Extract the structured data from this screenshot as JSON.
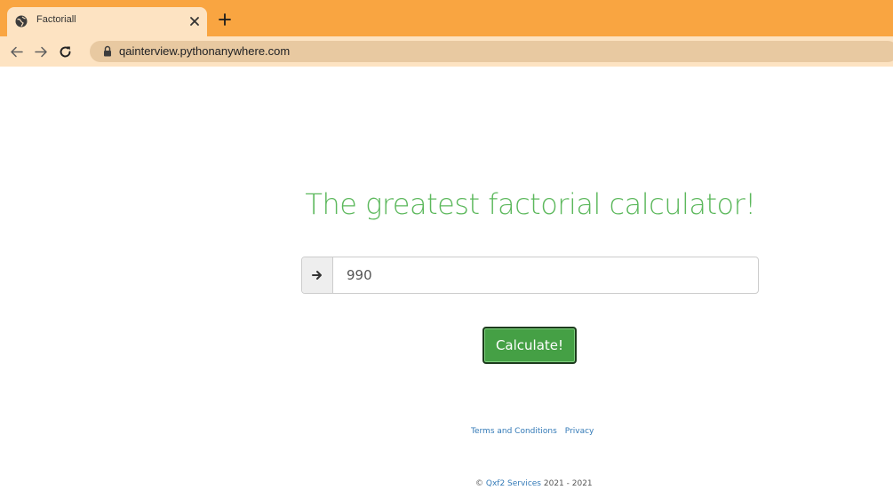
{
  "browser": {
    "tab_title": "Factoriall",
    "url": "qainterview.pythonanywhere.com"
  },
  "page": {
    "title": "The greatest factorial calculator!",
    "input_value": "990",
    "button_label": "Calculate!"
  },
  "footer": {
    "links": [
      "Terms and Conditions",
      "Privacy"
    ],
    "copyright_symbol": "©",
    "company": "Qxf2 Services",
    "years": "2021 - 2021"
  },
  "colors": {
    "tabstrip": "#f9a541",
    "toolbar": "#fde3c2",
    "title_green": "#5cb85c",
    "button_green": "#45a045",
    "link_blue": "#337ab7"
  }
}
